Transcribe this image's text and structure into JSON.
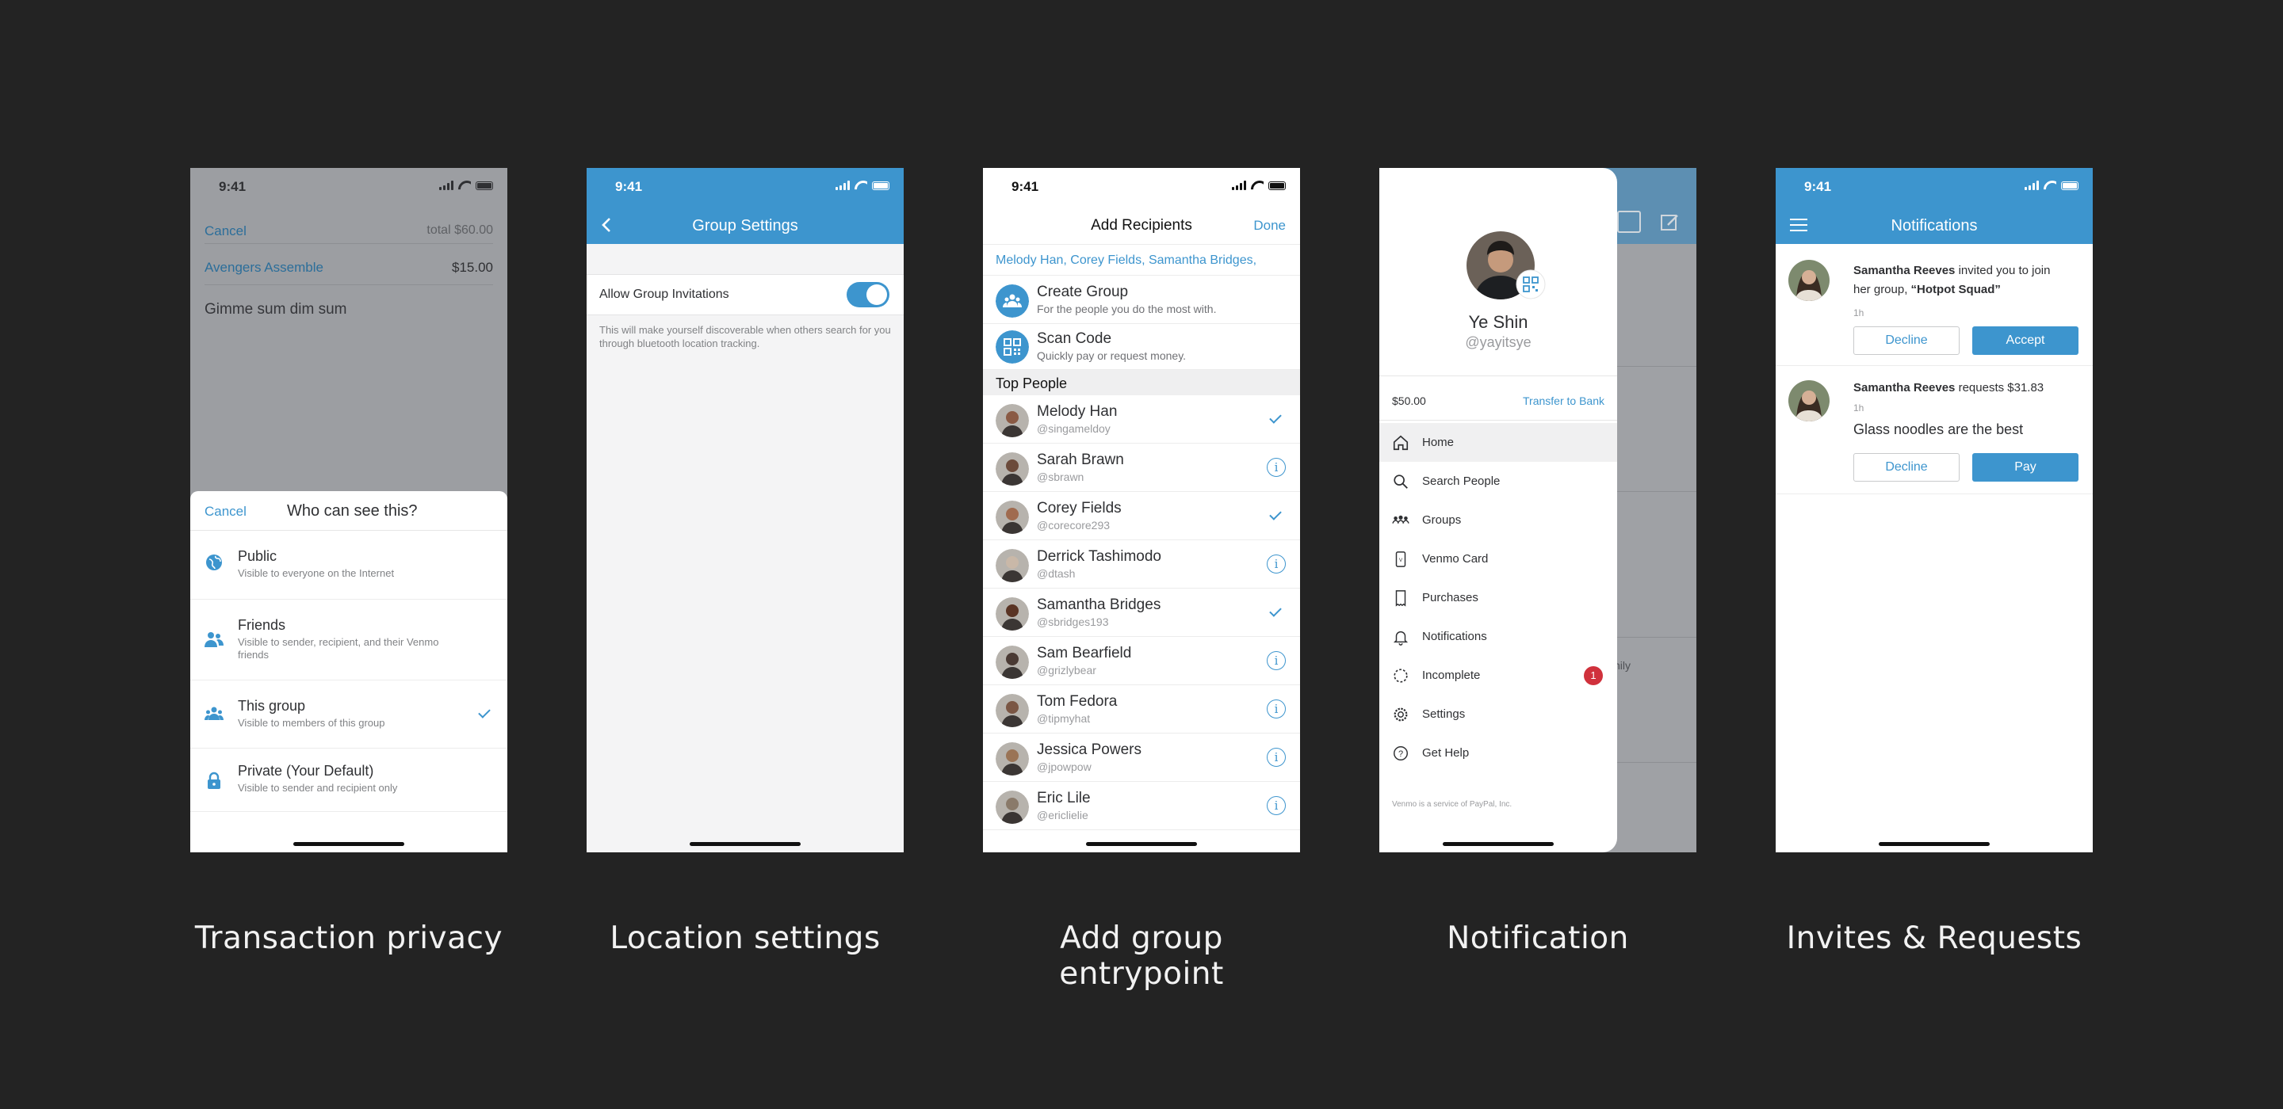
{
  "colors": {
    "accent": "#3d95ce",
    "background": "#232323",
    "badge": "#d0313c"
  },
  "captions": [
    "Transaction privacy",
    "Location settings",
    "Add group entrypoint",
    "Notification",
    "Invites & Requests"
  ],
  "status_time": "9:41",
  "privacy": {
    "cancel_label": "Cancel",
    "total": "total $60.00",
    "group_name": "Avengers Assemble",
    "amount": "$15.00",
    "note": "Gimme sum dim sum",
    "sheet_cancel": "Cancel",
    "sheet_title": "Who can see this?",
    "options": [
      {
        "title": "Public",
        "desc": "Visible to everyone on the Internet",
        "icon": "globe-icon",
        "selected": false
      },
      {
        "title": "Friends",
        "desc": "Visible to sender, recipient, and their Venmo friends",
        "icon": "friends-icon",
        "selected": false
      },
      {
        "title": "This group",
        "desc": "Visible to members of this group",
        "icon": "group-icon",
        "selected": true
      },
      {
        "title": "Private (Your Default)",
        "desc": "Visible to sender and recipient only",
        "icon": "lock-icon",
        "selected": false
      }
    ]
  },
  "location": {
    "title": "Group Settings",
    "toggle_label": "Allow Group Invitations",
    "toggle_on": true,
    "description": "This will make yourself discoverable when others search for you through bluetooth location tracking."
  },
  "recipients": {
    "title": "Add Recipients",
    "done_label": "Done",
    "selected_names": "Melody Han, Corey Fields, Samantha Bridges,",
    "actions": [
      {
        "title": "Create Group",
        "desc": "For the people you do the most with.",
        "icon": "create-group-icon"
      },
      {
        "title": "Scan Code",
        "desc": "Quickly pay or request money.",
        "icon": "qr-code-icon"
      }
    ],
    "section_title": "Top People",
    "people": [
      {
        "name": "Melody Han",
        "handle": "@singameldoy",
        "selected": true,
        "skin": "#8a5a44"
      },
      {
        "name": "Sarah Brawn",
        "handle": "@sbrawn",
        "selected": false,
        "skin": "#6b4a3a"
      },
      {
        "name": "Corey Fields",
        "handle": "@corecore293",
        "selected": true,
        "skin": "#a06b4f"
      },
      {
        "name": "Derrick Tashimodo",
        "handle": "@dtash",
        "selected": false,
        "skin": "#c9b8a8"
      },
      {
        "name": "Samantha Bridges",
        "handle": "@sbridges193",
        "selected": true,
        "skin": "#5a3424"
      },
      {
        "name": "Sam Bearfield",
        "handle": "@grizlybear",
        "selected": false,
        "skin": "#4a3a34"
      },
      {
        "name": "Tom Fedora",
        "handle": "@tipmyhat",
        "selected": false,
        "skin": "#7a5644"
      },
      {
        "name": "Jessica Powers",
        "handle": "@jpowpow",
        "selected": false,
        "skin": "#9a7456"
      },
      {
        "name": "Eric Lile",
        "handle": "@ericlielie",
        "selected": false,
        "skin": "#8a7a6a"
      }
    ]
  },
  "drawer": {
    "user_name": "Ye Shin",
    "user_handle": "@yayitsye",
    "balance": "$50.00",
    "transfer_label": "Transfer to Bank",
    "items": [
      {
        "label": "Home",
        "icon": "home-icon",
        "active": true
      },
      {
        "label": "Search People",
        "icon": "search-icon",
        "active": false
      },
      {
        "label": "Groups",
        "icon": "groups-icon",
        "active": false
      },
      {
        "label": "Venmo Card",
        "icon": "card-icon",
        "active": false
      },
      {
        "label": "Purchases",
        "icon": "receipt-icon",
        "active": false
      },
      {
        "label": "Notifications",
        "icon": "bell-icon",
        "active": false
      },
      {
        "label": "Incomplete",
        "icon": "incomplete-icon",
        "active": false,
        "badge": "1"
      },
      {
        "label": "Settings",
        "icon": "gear-icon",
        "active": false
      },
      {
        "label": "Get Help",
        "icon": "help-icon",
        "active": false
      }
    ],
    "footer": "Venmo is a service of PayPal, Inc.",
    "background_fragment": "nily"
  },
  "notifications": {
    "title": "Notifications",
    "items": [
      {
        "sender": "Samantha Reeves",
        "text_pre": " invited you to join her group, ",
        "group": "“Hotpot Squad”",
        "time": "1h",
        "decline": "Decline",
        "accept": "Accept"
      },
      {
        "sender": "Samantha Reeves",
        "text_pre": " requests $31.83",
        "time": "1h",
        "note": "Glass noodles are the best",
        "decline": "Decline",
        "pay": "Pay"
      }
    ]
  }
}
